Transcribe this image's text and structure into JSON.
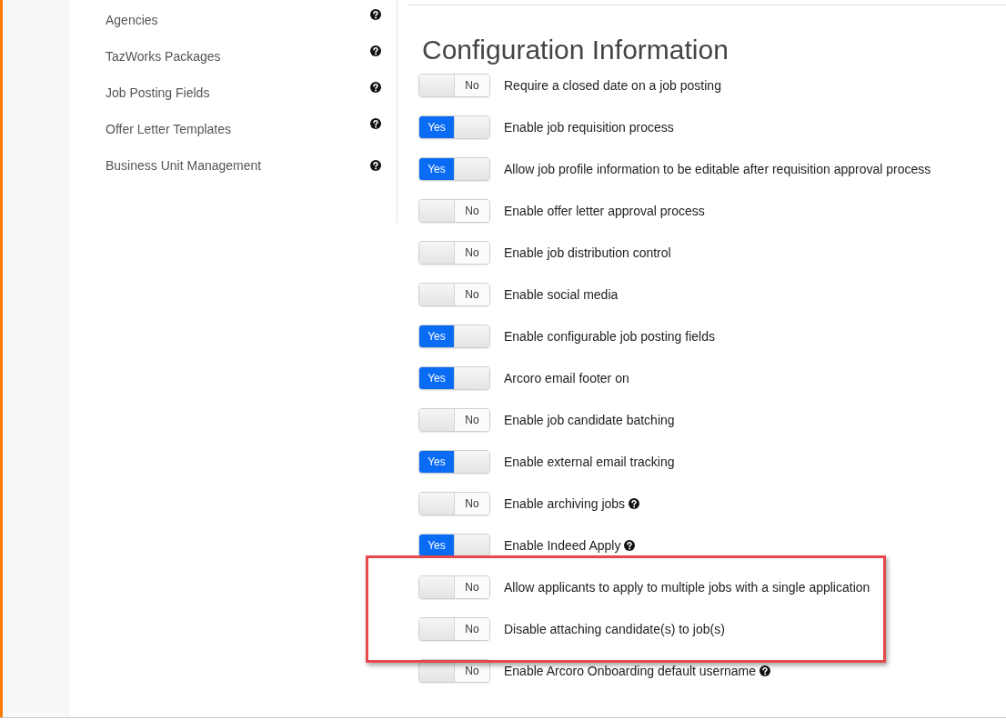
{
  "sidebar": {
    "items": [
      {
        "label": "Agencies",
        "help": true
      },
      {
        "label": "TazWorks Packages",
        "help": true
      },
      {
        "label": "Job Posting Fields",
        "help": true
      },
      {
        "label": "Offer Letter Templates",
        "help": true
      },
      {
        "label": "Business Unit Management",
        "help": true
      }
    ]
  },
  "main": {
    "title": "Configuration Information",
    "settings": [
      {
        "label": "Require a closed date on a job posting",
        "on": false,
        "switch_text": "No",
        "help": false,
        "highlighted": false
      },
      {
        "label": "Enable job requisition process",
        "on": true,
        "switch_text": "Yes",
        "help": false,
        "highlighted": false
      },
      {
        "label": "Allow job profile information to be editable after requisition approval process",
        "on": true,
        "switch_text": "Yes",
        "help": false,
        "highlighted": false
      },
      {
        "label": "Enable offer letter approval process",
        "on": false,
        "switch_text": "No",
        "help": false,
        "highlighted": false
      },
      {
        "label": "Enable job distribution control",
        "on": false,
        "switch_text": "No",
        "help": false,
        "highlighted": false
      },
      {
        "label": "Enable social media",
        "on": false,
        "switch_text": "No",
        "help": false,
        "highlighted": false
      },
      {
        "label": "Enable configurable job posting fields",
        "on": true,
        "switch_text": "Yes",
        "help": false,
        "highlighted": false
      },
      {
        "label": "Arcoro email footer on",
        "on": true,
        "switch_text": "Yes",
        "help": false,
        "highlighted": false
      },
      {
        "label": "Enable job candidate batching",
        "on": false,
        "switch_text": "No",
        "help": false,
        "highlighted": false
      },
      {
        "label": "Enable external email tracking",
        "on": true,
        "switch_text": "Yes",
        "help": false,
        "highlighted": false
      },
      {
        "label": "Enable archiving jobs",
        "on": false,
        "switch_text": "No",
        "help": true,
        "highlighted": false
      },
      {
        "label": "Enable Indeed Apply",
        "on": true,
        "switch_text": "Yes",
        "help": true,
        "highlighted": false
      },
      {
        "label": "Allow applicants to apply to multiple jobs with a single application",
        "on": false,
        "switch_text": "No",
        "help": false,
        "highlighted": true
      },
      {
        "label": "Disable attaching candidate(s) to job(s)",
        "on": false,
        "switch_text": "No",
        "help": false,
        "highlighted": true
      },
      {
        "label": "Enable Arcoro Onboarding default username",
        "on": false,
        "switch_text": "No",
        "help": true,
        "highlighted": false
      }
    ]
  }
}
